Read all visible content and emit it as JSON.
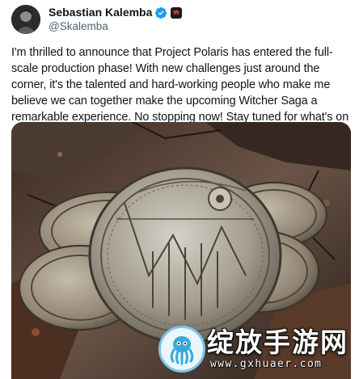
{
  "author": {
    "name": "Sebastian Kalemba",
    "handle": "@Skalemba",
    "verified_color": "#1d9bf0"
  },
  "tweet": {
    "text": "I'm thrilled to announce that Project Polaris has entered the full-scale production phase! With new challenges just around the corner, it's the talented and hard-working people who make me believe we can together make the upcoming Witcher Saga a remarkable experience. No stopping now! Stay tuned for what's on the other side of the coin!⚔️"
  },
  "media": {
    "icon": "coins-image",
    "watermark": {
      "title": "绽放手游网",
      "url": "www.gxhuaer.com",
      "icon": "octopus-icon"
    }
  }
}
